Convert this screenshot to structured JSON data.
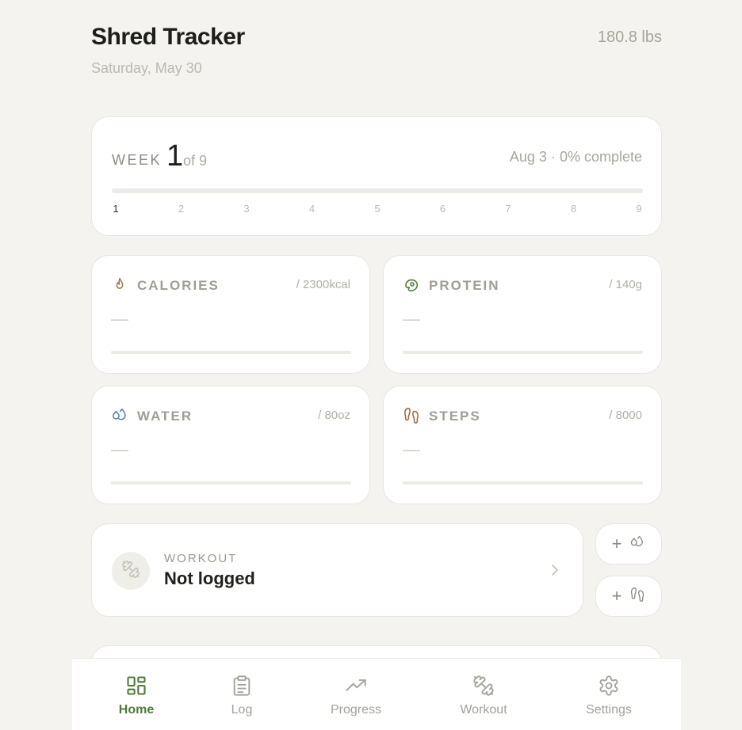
{
  "header": {
    "title": "Shred Tracker",
    "date": "Saturday, May 30",
    "weight": "180.8 lbs"
  },
  "week": {
    "label": "WEEK",
    "current": "1",
    "of_text": "of 9",
    "status": "Aug 3 · 0% complete",
    "progress_fraction": 0,
    "ticks": [
      "1",
      "2",
      "3",
      "4",
      "5",
      "6",
      "7",
      "8",
      "9"
    ],
    "accent": "#7a9a63"
  },
  "metrics": {
    "calories": {
      "label": "CALORIES",
      "goal": "/ 2300kcal",
      "value": "—",
      "icon": "flame-icon",
      "color": "#9c7a52"
    },
    "protein": {
      "label": "PROTEIN",
      "goal": "/ 140g",
      "value": "—",
      "icon": "steak-icon",
      "color": "#4f7a38"
    },
    "water": {
      "label": "WATER",
      "goal": "/ 80oz",
      "value": "—",
      "icon": "droplets-icon",
      "color": "#4f87b5"
    },
    "steps": {
      "label": "STEPS",
      "goal": "/ 8000",
      "value": "—",
      "icon": "footprints-icon",
      "color": "#9c6a3e"
    }
  },
  "workout": {
    "label": "WORKOUT",
    "status": "Not logged",
    "icon": "dumbbell-icon"
  },
  "quick_add": [
    {
      "symbol": "+",
      "icon": "droplets-icon"
    },
    {
      "symbol": "+",
      "icon": "footprints-icon"
    }
  ],
  "nav": {
    "items": [
      {
        "label": "Home",
        "icon": "grid-icon",
        "active": true
      },
      {
        "label": "Log",
        "icon": "clipboard-icon",
        "active": false
      },
      {
        "label": "Progress",
        "icon": "trending-up-icon",
        "active": false
      },
      {
        "label": "Workout",
        "icon": "dumbbell-icon",
        "active": false
      },
      {
        "label": "Settings",
        "icon": "gear-icon",
        "active": false
      }
    ],
    "active_color": "#4f7a38",
    "inactive_color": "#a4a19a"
  }
}
